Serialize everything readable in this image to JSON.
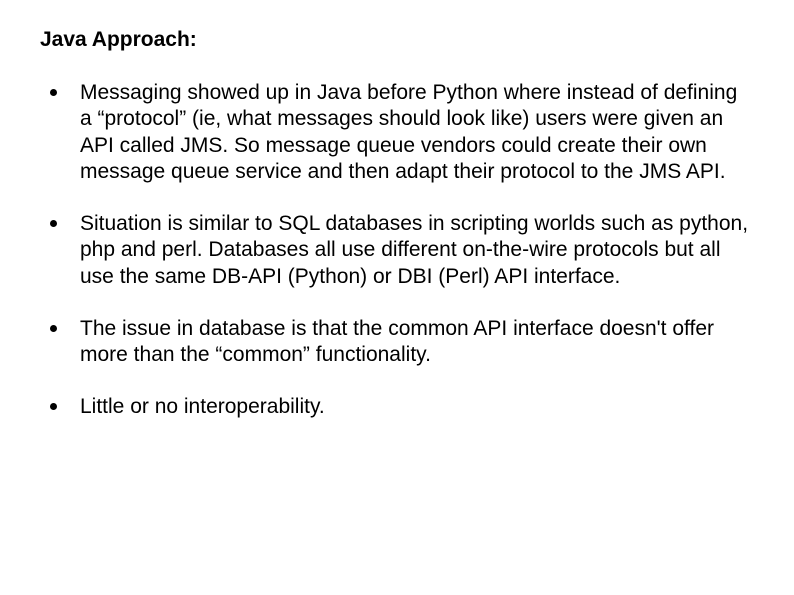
{
  "title": "Java Approach:",
  "bullets": [
    "Messaging showed up in Java before Python where instead of defining a “protocol” (ie, what messages should look like) users were given an API called JMS. So message queue vendors could create their own message queue service and then adapt their protocol to the JMS API.",
    "Situation is similar to SQL databases in scripting worlds such as python, php and perl. Databases all use different on-the-wire protocols but all use the same DB-API (Python) or DBI (Perl) API interface.",
    "The issue in database is that the common API interface doesn't offer more than the “common” functionality.",
    "Little or no interoperability."
  ]
}
